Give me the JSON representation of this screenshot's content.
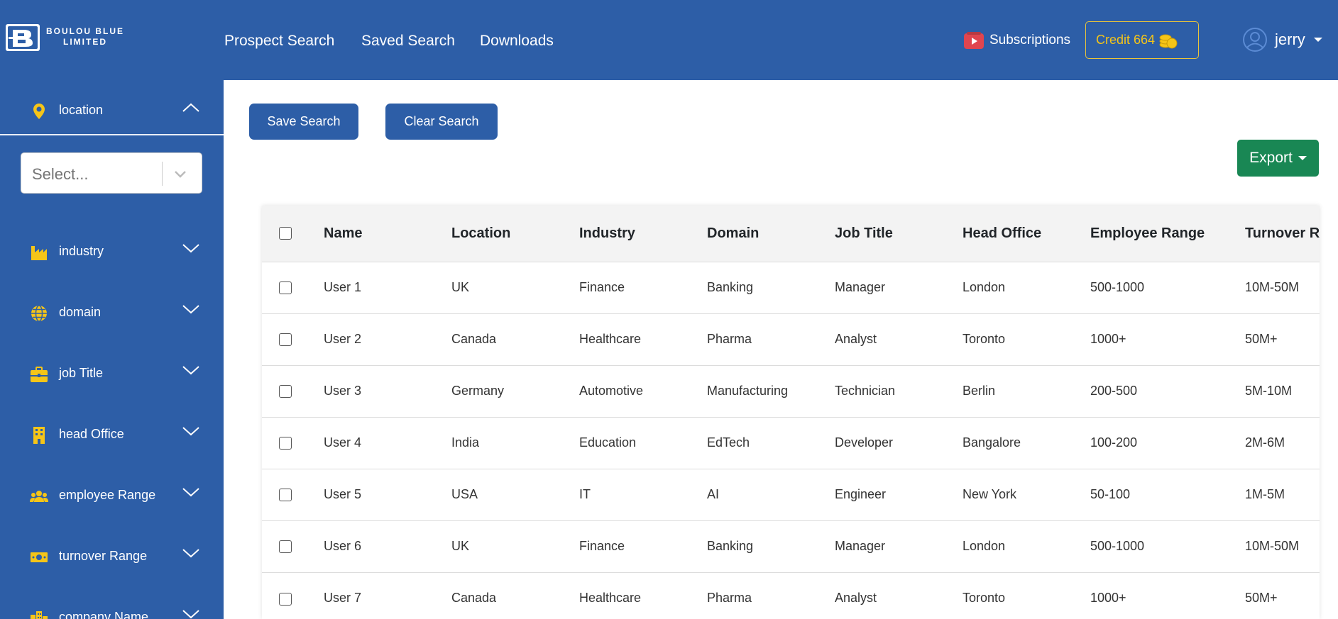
{
  "brand": {
    "name": "BOULOU BLUE LIMITED",
    "line1": "BOULOU BLUE",
    "line2": "LIMITED",
    "logo_icon": "b-logo-icon"
  },
  "nav": {
    "prospect_search": "Prospect Search",
    "saved_search": "Saved Search",
    "downloads": "Downloads"
  },
  "header": {
    "subscriptions_label": "Subscriptions",
    "subscriptions_icon": "play-icon",
    "credit_label": "Credit 664",
    "credit_icon": "coins-icon",
    "user_name": "jerry",
    "user_icon": "user-circle-icon"
  },
  "sidebar": {
    "location": {
      "label": "location",
      "icon": "map-pin-icon",
      "expanded": true
    },
    "location_select": {
      "placeholder": "Select..."
    },
    "filters": [
      {
        "label": "industry",
        "icon": "factory-icon"
      },
      {
        "label": "domain",
        "icon": "globe-icon"
      },
      {
        "label": "job Title",
        "icon": "briefcase-icon"
      },
      {
        "label": "head Office",
        "icon": "building-icon"
      },
      {
        "label": "employee Range",
        "icon": "users-icon"
      },
      {
        "label": "turnover Range",
        "icon": "money-icon"
      },
      {
        "label": "company Name",
        "icon": "city-icon"
      }
    ]
  },
  "actions": {
    "save_search": "Save Search",
    "clear_search": "Clear Search",
    "export": "Export"
  },
  "table": {
    "columns": [
      "Name",
      "Location",
      "Industry",
      "Domain",
      "Job Title",
      "Head Office",
      "Employee Range",
      "Turnover R"
    ],
    "rows": [
      [
        "User 1",
        "UK",
        "Finance",
        "Banking",
        "Manager",
        "London",
        "500-1000",
        "10M-50M"
      ],
      [
        "User 2",
        "Canada",
        "Healthcare",
        "Pharma",
        "Analyst",
        "Toronto",
        "1000+",
        "50M+"
      ],
      [
        "User 3",
        "Germany",
        "Automotive",
        "Manufacturing",
        "Technician",
        "Berlin",
        "200-500",
        "5M-10M"
      ],
      [
        "User 4",
        "India",
        "Education",
        "EdTech",
        "Developer",
        "Bangalore",
        "100-200",
        "2M-6M"
      ],
      [
        "User 5",
        "USA",
        "IT",
        "AI",
        "Engineer",
        "New York",
        "50-100",
        "1M-5M"
      ],
      [
        "User 6",
        "UK",
        "Finance",
        "Banking",
        "Manager",
        "London",
        "500-1000",
        "10M-50M"
      ],
      [
        "User 7",
        "Canada",
        "Healthcare",
        "Pharma",
        "Analyst",
        "Toronto",
        "1000+",
        "50M+"
      ]
    ]
  },
  "colors": {
    "primary": "#2d5ea7",
    "accent_yellow": "#f5c518",
    "export_green": "#198754",
    "subscriptions_red": "#e0454f"
  }
}
